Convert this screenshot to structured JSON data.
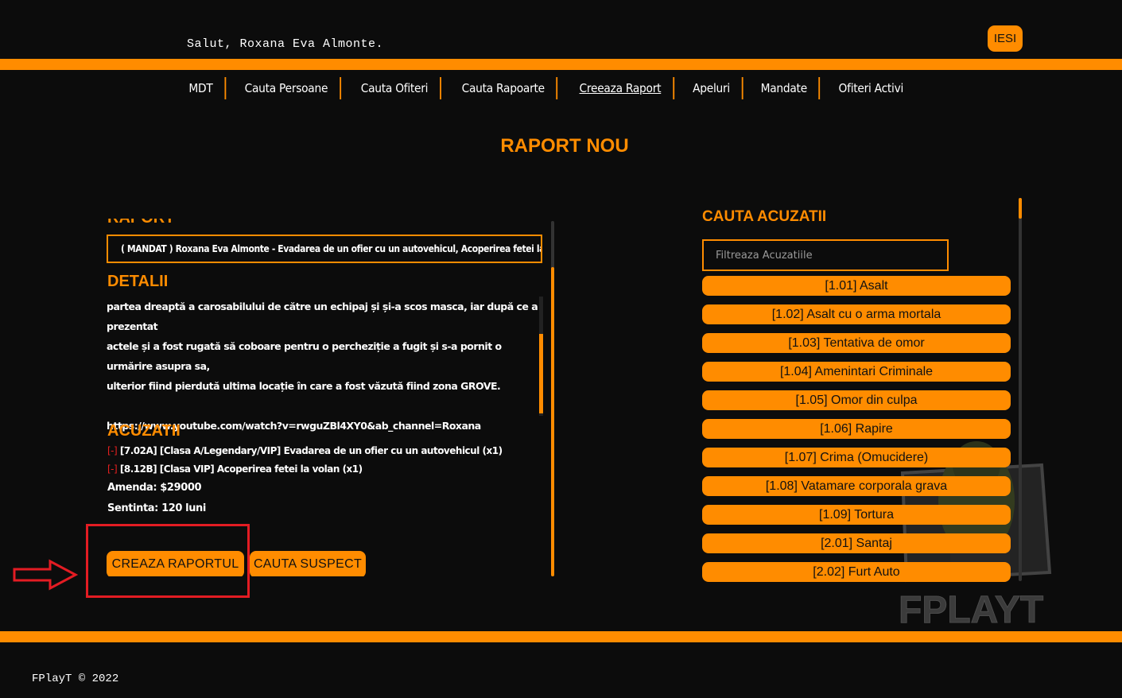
{
  "header": {
    "greeting": "Salut, Roxana Eva Almonte.",
    "logout_label": "IESI"
  },
  "nav": {
    "items": [
      "MDT",
      "Cauta Persoane",
      "Cauta Ofiteri",
      "Cauta Rapoarte",
      "Creeaza Raport",
      "Apeluri",
      "Mandate",
      "Ofiteri Activi"
    ],
    "active": "Creeaza Raport"
  },
  "page_title": "RAPORT NOU",
  "report": {
    "raport_label": "RAPORT",
    "raport_value": "( MANDAT ) Roxana Eva Almonte - Evadarea de un ofier cu un autovehicul, Acoperirea fetei la volan",
    "detalii_label": "DETALII",
    "detalii_lines": [
      "partea dreaptă a carosabilului de către un echipaj și și-a scos masca, iar după ce a prezentat",
      "actele și a fost rugată să coboare pentru o percheziție a fugit și s-a pornit o urmărire asupra sa,",
      "ulterior fiind pierdută ultima locație în care a fost văzută fiind zona GROVE.",
      "",
      "https://www.youtube.com/watch?v=rwguZBl4XY0&ab_channel=Roxana"
    ],
    "acuzatii_label": "ACUZATII",
    "remove_symbol": "[-]",
    "charges": [
      "[7.02A] [Clasa A/Legendary/VIP] Evadarea de un ofier cu un autovehicul (x1)",
      "[8.12B] [Clasa VIP] Acoperirea fetei la volan (x1)"
    ],
    "amenda": "Amenda: $29000",
    "sentinta": "Sentinta: 120 luni",
    "create_button": "CREAZA RAPORTUL",
    "search_button": "CAUTA SUSPECT"
  },
  "search_charges": {
    "title": "CAUTA ACUZATII",
    "filter_placeholder": "Filtreaza Acuzatiile",
    "items": [
      "[1.01] Asalt",
      "[1.02] Asalt cu o arma mortala",
      "[1.03] Tentativa de omor",
      "[1.04] Amenintari Criminale",
      "[1.05] Omor din culpa",
      "[1.06] Rapire",
      "[1.07] Crima (Omucidere)",
      "[1.08] Vatamare corporala grava",
      "[1.09] Tortura",
      "[2.01] Santaj",
      "[2.02] Furt Auto"
    ]
  },
  "watermark": "FPLAYT",
  "footer": "FPlayT © 2022",
  "colors": {
    "accent": "#ff8c00",
    "background": "#0c0c0c",
    "annotation": "#e31c23"
  }
}
